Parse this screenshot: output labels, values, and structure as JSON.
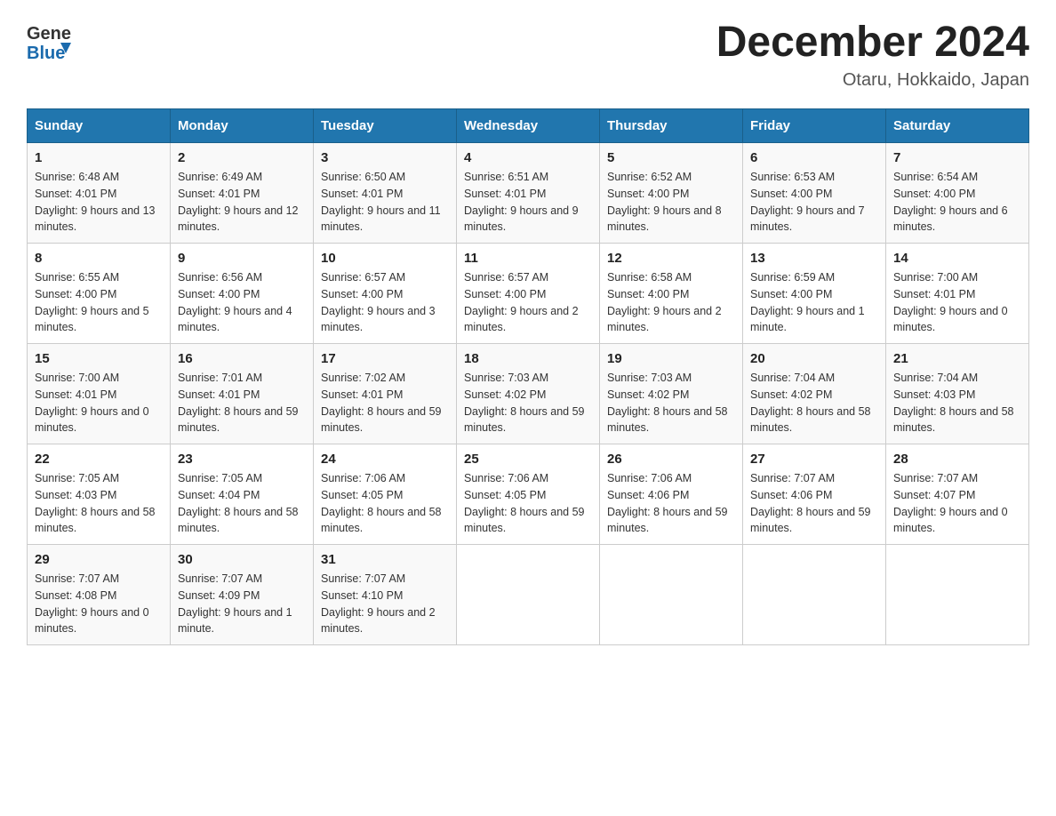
{
  "header": {
    "logo_general": "General",
    "logo_blue": "Blue",
    "month_title": "December 2024",
    "location": "Otaru, Hokkaido, Japan"
  },
  "days_of_week": [
    "Sunday",
    "Monday",
    "Tuesday",
    "Wednesday",
    "Thursday",
    "Friday",
    "Saturday"
  ],
  "weeks": [
    [
      {
        "num": "1",
        "sunrise": "6:48 AM",
        "sunset": "4:01 PM",
        "daylight": "9 hours and 13 minutes."
      },
      {
        "num": "2",
        "sunrise": "6:49 AM",
        "sunset": "4:01 PM",
        "daylight": "9 hours and 12 minutes."
      },
      {
        "num": "3",
        "sunrise": "6:50 AM",
        "sunset": "4:01 PM",
        "daylight": "9 hours and 11 minutes."
      },
      {
        "num": "4",
        "sunrise": "6:51 AM",
        "sunset": "4:01 PM",
        "daylight": "9 hours and 9 minutes."
      },
      {
        "num": "5",
        "sunrise": "6:52 AM",
        "sunset": "4:00 PM",
        "daylight": "9 hours and 8 minutes."
      },
      {
        "num": "6",
        "sunrise": "6:53 AM",
        "sunset": "4:00 PM",
        "daylight": "9 hours and 7 minutes."
      },
      {
        "num": "7",
        "sunrise": "6:54 AM",
        "sunset": "4:00 PM",
        "daylight": "9 hours and 6 minutes."
      }
    ],
    [
      {
        "num": "8",
        "sunrise": "6:55 AM",
        "sunset": "4:00 PM",
        "daylight": "9 hours and 5 minutes."
      },
      {
        "num": "9",
        "sunrise": "6:56 AM",
        "sunset": "4:00 PM",
        "daylight": "9 hours and 4 minutes."
      },
      {
        "num": "10",
        "sunrise": "6:57 AM",
        "sunset": "4:00 PM",
        "daylight": "9 hours and 3 minutes."
      },
      {
        "num": "11",
        "sunrise": "6:57 AM",
        "sunset": "4:00 PM",
        "daylight": "9 hours and 2 minutes."
      },
      {
        "num": "12",
        "sunrise": "6:58 AM",
        "sunset": "4:00 PM",
        "daylight": "9 hours and 2 minutes."
      },
      {
        "num": "13",
        "sunrise": "6:59 AM",
        "sunset": "4:00 PM",
        "daylight": "9 hours and 1 minute."
      },
      {
        "num": "14",
        "sunrise": "7:00 AM",
        "sunset": "4:01 PM",
        "daylight": "9 hours and 0 minutes."
      }
    ],
    [
      {
        "num": "15",
        "sunrise": "7:00 AM",
        "sunset": "4:01 PM",
        "daylight": "9 hours and 0 minutes."
      },
      {
        "num": "16",
        "sunrise": "7:01 AM",
        "sunset": "4:01 PM",
        "daylight": "8 hours and 59 minutes."
      },
      {
        "num": "17",
        "sunrise": "7:02 AM",
        "sunset": "4:01 PM",
        "daylight": "8 hours and 59 minutes."
      },
      {
        "num": "18",
        "sunrise": "7:03 AM",
        "sunset": "4:02 PM",
        "daylight": "8 hours and 59 minutes."
      },
      {
        "num": "19",
        "sunrise": "7:03 AM",
        "sunset": "4:02 PM",
        "daylight": "8 hours and 58 minutes."
      },
      {
        "num": "20",
        "sunrise": "7:04 AM",
        "sunset": "4:02 PM",
        "daylight": "8 hours and 58 minutes."
      },
      {
        "num": "21",
        "sunrise": "7:04 AM",
        "sunset": "4:03 PM",
        "daylight": "8 hours and 58 minutes."
      }
    ],
    [
      {
        "num": "22",
        "sunrise": "7:05 AM",
        "sunset": "4:03 PM",
        "daylight": "8 hours and 58 minutes."
      },
      {
        "num": "23",
        "sunrise": "7:05 AM",
        "sunset": "4:04 PM",
        "daylight": "8 hours and 58 minutes."
      },
      {
        "num": "24",
        "sunrise": "7:06 AM",
        "sunset": "4:05 PM",
        "daylight": "8 hours and 58 minutes."
      },
      {
        "num": "25",
        "sunrise": "7:06 AM",
        "sunset": "4:05 PM",
        "daylight": "8 hours and 59 minutes."
      },
      {
        "num": "26",
        "sunrise": "7:06 AM",
        "sunset": "4:06 PM",
        "daylight": "8 hours and 59 minutes."
      },
      {
        "num": "27",
        "sunrise": "7:07 AM",
        "sunset": "4:06 PM",
        "daylight": "8 hours and 59 minutes."
      },
      {
        "num": "28",
        "sunrise": "7:07 AM",
        "sunset": "4:07 PM",
        "daylight": "9 hours and 0 minutes."
      }
    ],
    [
      {
        "num": "29",
        "sunrise": "7:07 AM",
        "sunset": "4:08 PM",
        "daylight": "9 hours and 0 minutes."
      },
      {
        "num": "30",
        "sunrise": "7:07 AM",
        "sunset": "4:09 PM",
        "daylight": "9 hours and 1 minute."
      },
      {
        "num": "31",
        "sunrise": "7:07 AM",
        "sunset": "4:10 PM",
        "daylight": "9 hours and 2 minutes."
      },
      null,
      null,
      null,
      null
    ]
  ],
  "labels": {
    "sunrise": "Sunrise:",
    "sunset": "Sunset:",
    "daylight": "Daylight:"
  }
}
